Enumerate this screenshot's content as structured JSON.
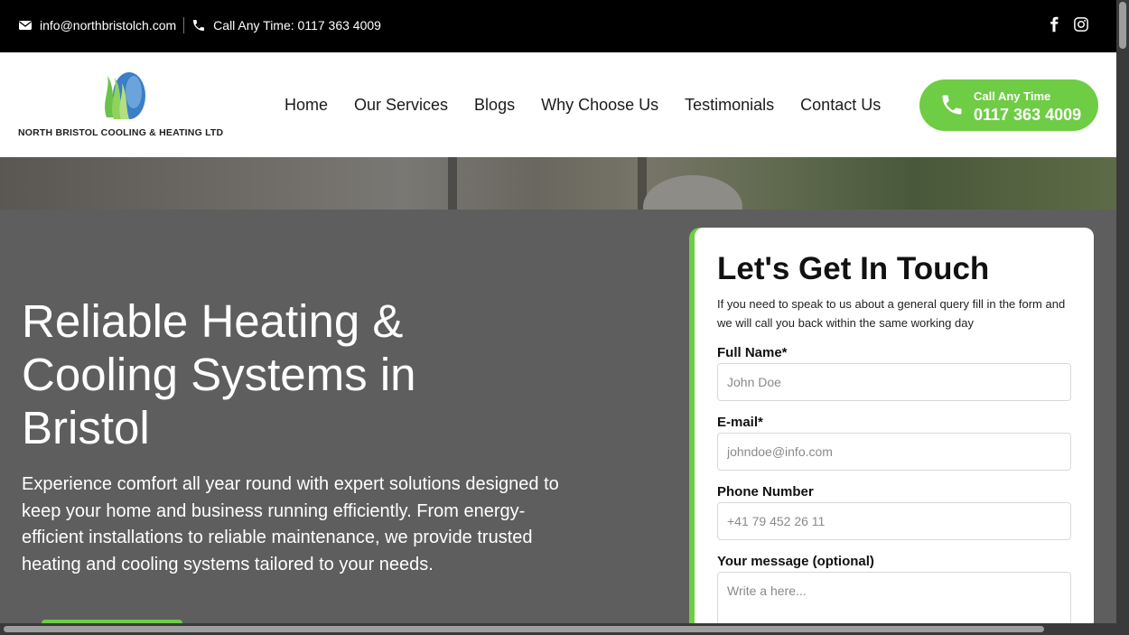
{
  "topbar": {
    "email": "info@northbristolch.com",
    "phone": "Call Any Time: 0117 363 4009",
    "icons": [
      "envelope-icon",
      "phone-icon",
      "facebook-icon",
      "instagram-icon"
    ]
  },
  "header": {
    "logo_text": "NORTH BRISTOL COOLING & HEATING LTD",
    "nav": [
      "Home",
      "Our Services",
      "Blogs",
      "Why Choose Us",
      "Testimonials",
      "Contact Us"
    ],
    "call_button": {
      "small": "Call Any Time",
      "number": "0117 363 4009"
    }
  },
  "hero": {
    "title": "Reliable Heating & Cooling Systems in Bristol",
    "description": "Experience comfort all year round with expert solutions designed to keep your home and business running efficiently. From energy-efficient installations to reliable maintenance, we provide trusted heating and cooling systems tailored to your needs."
  },
  "form": {
    "title": "Let's Get In Touch",
    "subtitle": "If you need to speak to us about a general query fill in the form and we will call you back within the same working day",
    "fields": [
      {
        "label": "Full Name*",
        "placeholder": "John Doe"
      },
      {
        "label": "E-mail*",
        "placeholder": "johndoe@info.com"
      },
      {
        "label": "Phone Number",
        "placeholder": "+41 79 452 26 11"
      },
      {
        "label": "Your message (optional)",
        "placeholder": "Write a here..."
      }
    ]
  },
  "colors": {
    "accent": "#6fcc45",
    "topbar_bg": "#000000",
    "hero_overlay": "#5e5e5e",
    "text_dark": "#111111"
  }
}
